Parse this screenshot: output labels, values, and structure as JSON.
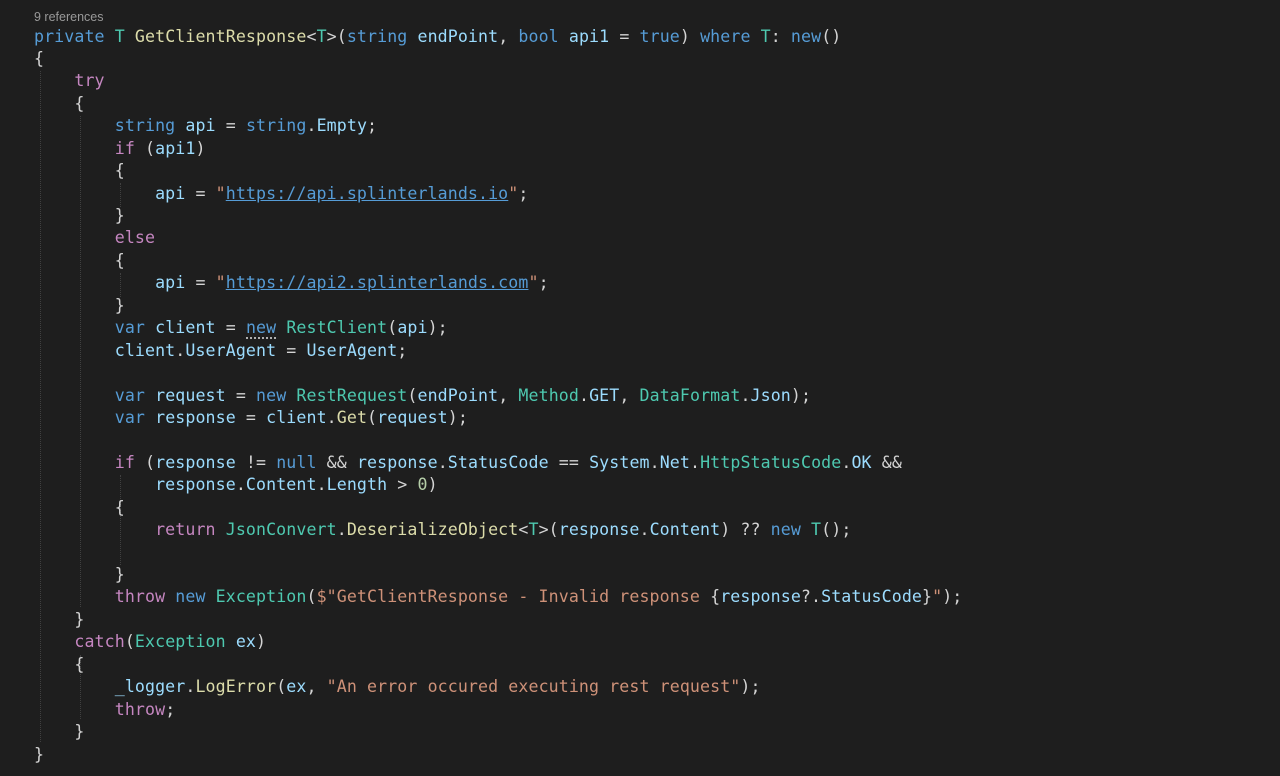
{
  "editor": {
    "codelens": "9 references",
    "lines": [
      [
        [
          "kw",
          "private"
        ],
        [
          "pn",
          " "
        ],
        [
          "ty",
          "T"
        ],
        [
          "pn",
          " "
        ],
        [
          "fn",
          "GetClientResponse"
        ],
        [
          "pn",
          "<"
        ],
        [
          "ty",
          "T"
        ],
        [
          "pn",
          ">("
        ],
        [
          "kw",
          "string"
        ],
        [
          "pn",
          " "
        ],
        [
          "id",
          "endPoint"
        ],
        [
          "pn",
          ", "
        ],
        [
          "kw",
          "bool"
        ],
        [
          "pn",
          " "
        ],
        [
          "id",
          "api1"
        ],
        [
          "pn",
          " = "
        ],
        [
          "kw",
          "true"
        ],
        [
          "pn",
          ") "
        ],
        [
          "kw",
          "where"
        ],
        [
          "pn",
          " "
        ],
        [
          "ty",
          "T"
        ],
        [
          "pn",
          ": "
        ],
        [
          "kw",
          "new"
        ],
        [
          "pn",
          "()"
        ]
      ],
      [
        [
          "pn",
          "{"
        ]
      ],
      [
        [
          "pn",
          "    "
        ],
        [
          "ctl",
          "try"
        ]
      ],
      [
        [
          "pn",
          "    {"
        ]
      ],
      [
        [
          "pn",
          "        "
        ],
        [
          "kw",
          "string"
        ],
        [
          "pn",
          " "
        ],
        [
          "id",
          "api"
        ],
        [
          "pn",
          " = "
        ],
        [
          "kw",
          "string"
        ],
        [
          "pn",
          "."
        ],
        [
          "id",
          "Empty"
        ],
        [
          "pn",
          ";"
        ]
      ],
      [
        [
          "pn",
          "        "
        ],
        [
          "ctl",
          "if"
        ],
        [
          "pn",
          " ("
        ],
        [
          "id",
          "api1"
        ],
        [
          "pn",
          ")"
        ]
      ],
      [
        [
          "pn",
          "        {"
        ]
      ],
      [
        [
          "pn",
          "            "
        ],
        [
          "id",
          "api"
        ],
        [
          "pn",
          " = "
        ],
        [
          "str",
          "\""
        ],
        [
          "url",
          "https://api.splinterlands.io"
        ],
        [
          "str",
          "\""
        ],
        [
          "pn",
          ";"
        ]
      ],
      [
        [
          "pn",
          "        }"
        ]
      ],
      [
        [
          "pn",
          "        "
        ],
        [
          "ctl",
          "else"
        ]
      ],
      [
        [
          "pn",
          "        {"
        ]
      ],
      [
        [
          "pn",
          "            "
        ],
        [
          "id",
          "api"
        ],
        [
          "pn",
          " = "
        ],
        [
          "str",
          "\""
        ],
        [
          "url",
          "https://api2.splinterlands.com"
        ],
        [
          "str",
          "\""
        ],
        [
          "pn",
          ";"
        ]
      ],
      [
        [
          "pn",
          "        }"
        ]
      ],
      [
        [
          "pn",
          "        "
        ],
        [
          "kw",
          "var"
        ],
        [
          "pn",
          " "
        ],
        [
          "id",
          "client"
        ],
        [
          "pn",
          " = "
        ],
        [
          "kwd",
          "new"
        ],
        [
          "pn",
          " "
        ],
        [
          "ty",
          "RestClient"
        ],
        [
          "pn",
          "("
        ],
        [
          "id",
          "api"
        ],
        [
          "pn",
          ");"
        ]
      ],
      [
        [
          "pn",
          "        "
        ],
        [
          "id",
          "client"
        ],
        [
          "pn",
          "."
        ],
        [
          "id",
          "UserAgent"
        ],
        [
          "pn",
          " = "
        ],
        [
          "id",
          "UserAgent"
        ],
        [
          "pn",
          ";"
        ]
      ],
      [],
      [
        [
          "pn",
          "        "
        ],
        [
          "kw",
          "var"
        ],
        [
          "pn",
          " "
        ],
        [
          "id",
          "request"
        ],
        [
          "pn",
          " = "
        ],
        [
          "kw",
          "new"
        ],
        [
          "pn",
          " "
        ],
        [
          "ty",
          "RestRequest"
        ],
        [
          "pn",
          "("
        ],
        [
          "id",
          "endPoint"
        ],
        [
          "pn",
          ", "
        ],
        [
          "ty",
          "Method"
        ],
        [
          "pn",
          "."
        ],
        [
          "id",
          "GET"
        ],
        [
          "pn",
          ", "
        ],
        [
          "ty",
          "DataFormat"
        ],
        [
          "pn",
          "."
        ],
        [
          "id",
          "Json"
        ],
        [
          "pn",
          ");"
        ]
      ],
      [
        [
          "pn",
          "        "
        ],
        [
          "kw",
          "var"
        ],
        [
          "pn",
          " "
        ],
        [
          "id",
          "response"
        ],
        [
          "pn",
          " = "
        ],
        [
          "id",
          "client"
        ],
        [
          "pn",
          "."
        ],
        [
          "fn",
          "Get"
        ],
        [
          "pn",
          "("
        ],
        [
          "id",
          "request"
        ],
        [
          "pn",
          ");"
        ]
      ],
      [],
      [
        [
          "pn",
          "        "
        ],
        [
          "ctl",
          "if"
        ],
        [
          "pn",
          " ("
        ],
        [
          "id",
          "response"
        ],
        [
          "pn",
          " != "
        ],
        [
          "kw",
          "null"
        ],
        [
          "pn",
          " && "
        ],
        [
          "id",
          "response"
        ],
        [
          "pn",
          "."
        ],
        [
          "id",
          "StatusCode"
        ],
        [
          "pn",
          " == "
        ],
        [
          "id",
          "System"
        ],
        [
          "pn",
          "."
        ],
        [
          "id",
          "Net"
        ],
        [
          "pn",
          "."
        ],
        [
          "ty",
          "HttpStatusCode"
        ],
        [
          "pn",
          "."
        ],
        [
          "id",
          "OK"
        ],
        [
          "pn",
          " &&"
        ]
      ],
      [
        [
          "pn",
          "            "
        ],
        [
          "id",
          "response"
        ],
        [
          "pn",
          "."
        ],
        [
          "id",
          "Content"
        ],
        [
          "pn",
          "."
        ],
        [
          "id",
          "Length"
        ],
        [
          "pn",
          " > "
        ],
        [
          "num",
          "0"
        ],
        [
          "pn",
          ")"
        ]
      ],
      [
        [
          "pn",
          "        {"
        ]
      ],
      [
        [
          "pn",
          "            "
        ],
        [
          "ctl",
          "return"
        ],
        [
          "pn",
          " "
        ],
        [
          "ty",
          "JsonConvert"
        ],
        [
          "pn",
          "."
        ],
        [
          "fn",
          "DeserializeObject"
        ],
        [
          "pn",
          "<"
        ],
        [
          "ty",
          "T"
        ],
        [
          "pn",
          ">("
        ],
        [
          "id",
          "response"
        ],
        [
          "pn",
          "."
        ],
        [
          "id",
          "Content"
        ],
        [
          "pn",
          ") ?? "
        ],
        [
          "kw",
          "new"
        ],
        [
          "pn",
          " "
        ],
        [
          "ty",
          "T"
        ],
        [
          "pn",
          "();"
        ]
      ],
      [],
      [
        [
          "pn",
          "        }"
        ]
      ],
      [
        [
          "pn",
          "        "
        ],
        [
          "ctl",
          "throw"
        ],
        [
          "pn",
          " "
        ],
        [
          "kw",
          "new"
        ],
        [
          "pn",
          " "
        ],
        [
          "ty",
          "Exception"
        ],
        [
          "pn",
          "("
        ],
        [
          "str",
          "$\"GetClientResponse - Invalid response "
        ],
        [
          "pn",
          "{"
        ],
        [
          "id",
          "response"
        ],
        [
          "pn",
          "?."
        ],
        [
          "id",
          "StatusCode"
        ],
        [
          "pn",
          "}"
        ],
        [
          "str",
          "\""
        ],
        [
          "pn",
          ");"
        ]
      ],
      [
        [
          "pn",
          "    }"
        ]
      ],
      [
        [
          "pn",
          "    "
        ],
        [
          "ctl",
          "catch"
        ],
        [
          "pn",
          "("
        ],
        [
          "ty",
          "Exception"
        ],
        [
          "pn",
          " "
        ],
        [
          "id",
          "ex"
        ],
        [
          "pn",
          ")"
        ]
      ],
      [
        [
          "pn",
          "    {"
        ]
      ],
      [
        [
          "pn",
          "        "
        ],
        [
          "id",
          "_logger"
        ],
        [
          "pn",
          "."
        ],
        [
          "fn",
          "LogError"
        ],
        [
          "pn",
          "("
        ],
        [
          "id",
          "ex"
        ],
        [
          "pn",
          ", "
        ],
        [
          "str",
          "\"An error occured executing rest request\""
        ],
        [
          "pn",
          ");"
        ]
      ],
      [
        [
          "pn",
          "        "
        ],
        [
          "ctl",
          "throw"
        ],
        [
          "pn",
          ";"
        ]
      ],
      [
        [
          "pn",
          "    }"
        ]
      ],
      [
        [
          "pn",
          "}"
        ]
      ]
    ]
  }
}
